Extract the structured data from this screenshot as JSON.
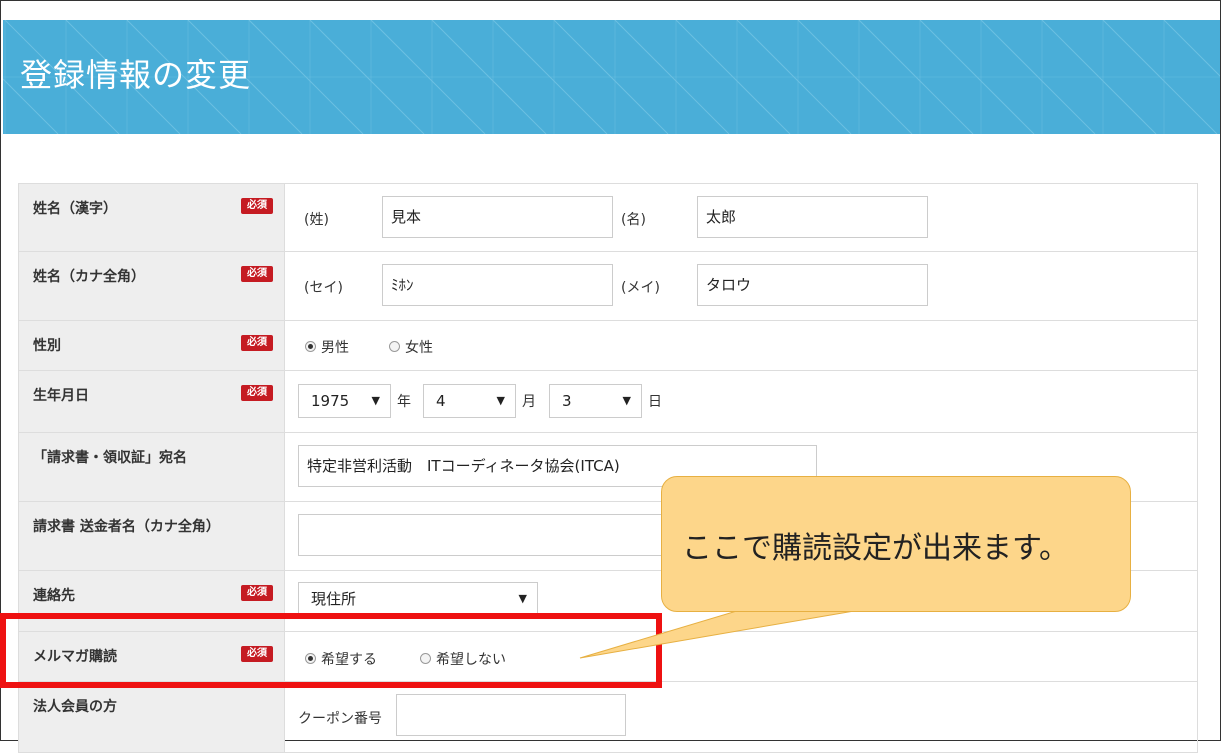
{
  "page": {
    "title": "登録情報の変更"
  },
  "colors": {
    "header": "#4aaed8",
    "required_badge": "#c51b22",
    "highlight": "#ee1111",
    "balloon": "#fdd68a"
  },
  "required_label": "必須",
  "form": {
    "name_kanji": {
      "label": "姓名（漢字）",
      "last_label": "(姓)",
      "last_value": "見本",
      "first_label": "(名)",
      "first_value": "太郎"
    },
    "name_kana": {
      "label": "姓名（カナ全角）",
      "last_label": "(セイ)",
      "last_value": "ﾐﾎﾝ",
      "first_label": "(メイ)",
      "first_value": "タロウ"
    },
    "gender": {
      "label": "性別",
      "options": [
        "男性",
        "女性"
      ],
      "selected": "男性"
    },
    "birthday": {
      "label": "生年月日",
      "year": "1975",
      "year_unit": "年",
      "month": "4",
      "month_unit": "月",
      "day": "3",
      "day_unit": "日"
    },
    "invoice_name": {
      "label": "「請求書・領収証」宛名",
      "value": "特定非営利活動　ITコーディネータ協会(ITCA)"
    },
    "sender_kana": {
      "label": "請求書 送金者名（カナ全角）",
      "value": ""
    },
    "contact": {
      "label": "連絡先",
      "value": "現住所"
    },
    "newsletter": {
      "label": "メルマガ購読",
      "options": [
        "希望する",
        "希望しない"
      ],
      "selected": "希望する"
    },
    "corporate": {
      "label": "法人会員の方",
      "coupon_label": "クーポン番号",
      "coupon_value": ""
    }
  },
  "callout": {
    "text": "ここで購読設定が出来ます。"
  }
}
